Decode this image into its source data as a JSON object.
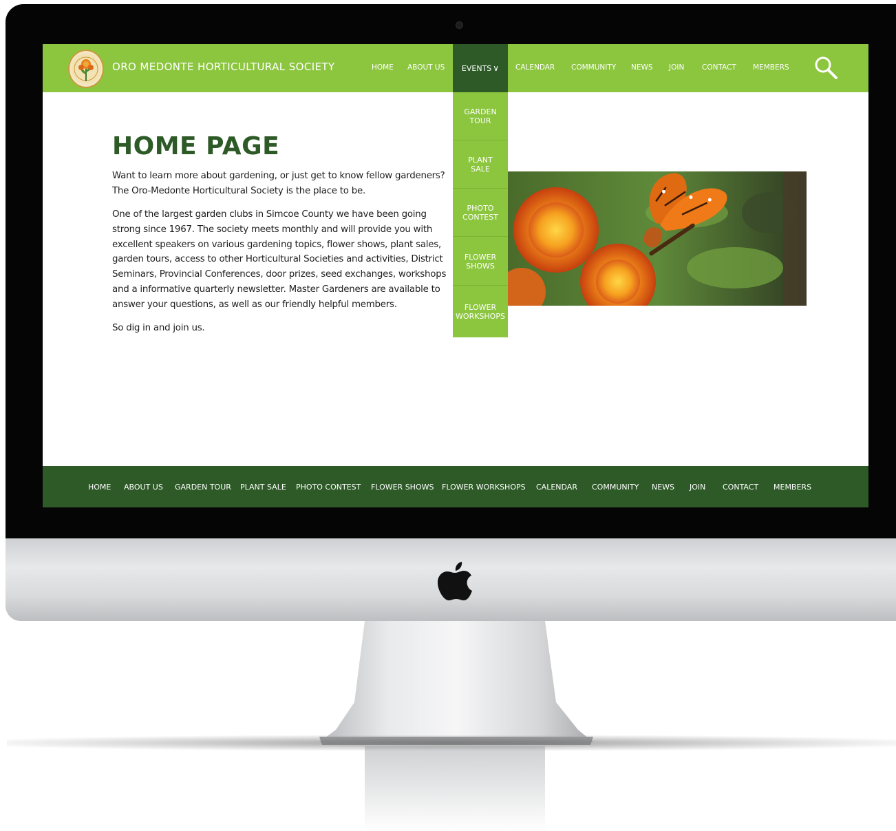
{
  "site": {
    "title": "ORO MEDONTE HORTICULTURAL SOCIETY"
  },
  "topnav": {
    "items": [
      "HOME",
      "ABOUT US",
      "EVENTS",
      "CALENDAR",
      "COMMUNITY",
      "NEWS",
      "JOIN",
      "CONTACT",
      "MEMBERS"
    ],
    "active": "EVENTS",
    "events_chevron": "∨"
  },
  "dropdown": {
    "items": [
      {
        "line1": "GARDEN",
        "line2": "TOUR"
      },
      {
        "line1": "PLANT",
        "line2": "SALE"
      },
      {
        "line1": "PHOTO",
        "line2": "CONTEST"
      },
      {
        "line1": "FLOWER",
        "line2": "SHOWS"
      },
      {
        "line1": "FLOWER",
        "line2": "WORKSHOPS"
      }
    ]
  },
  "content": {
    "heading": "HOME PAGE",
    "paragraphs": [
      "Want to learn more about gardening, or just get to know fellow gardeners? The Oro-Medonte Horticultural Society is the place to be.",
      "One of the largest garden clubs in Simcoe County we have been going strong since 1967.  The society meets monthly and will provide you with excellent speakers on various gardening topics, flower shows, plant sales, garden tours, access to other Horticultural Societies and activities, District Seminars, Provincial Conferences, door prizes, seed exchanges, workshops and a informative quarterly newsletter.  Master Gardeners are available to answer your questions, as well as our friendly helpful members.",
      "So dig in and join us."
    ]
  },
  "footer": {
    "items": [
      "HOME",
      "ABOUT US",
      "GARDEN TOUR",
      "PLANT SALE",
      "PHOTO CONTEST",
      "FLOWER SHOWS",
      "FLOWER WORKSHOPS",
      "CALENDAR",
      "COMMUNITY",
      "NEWS",
      "JOIN",
      "CONTACT",
      "MEMBERS"
    ]
  },
  "colors": {
    "header_green": "#8cc63f",
    "dark_green": "#2d5a27",
    "text": "#1e1e1e",
    "bezel": "#050505"
  },
  "icons": [
    "search-icon",
    "apple-logo-icon",
    "chevron-down-icon",
    "society-logo"
  ]
}
